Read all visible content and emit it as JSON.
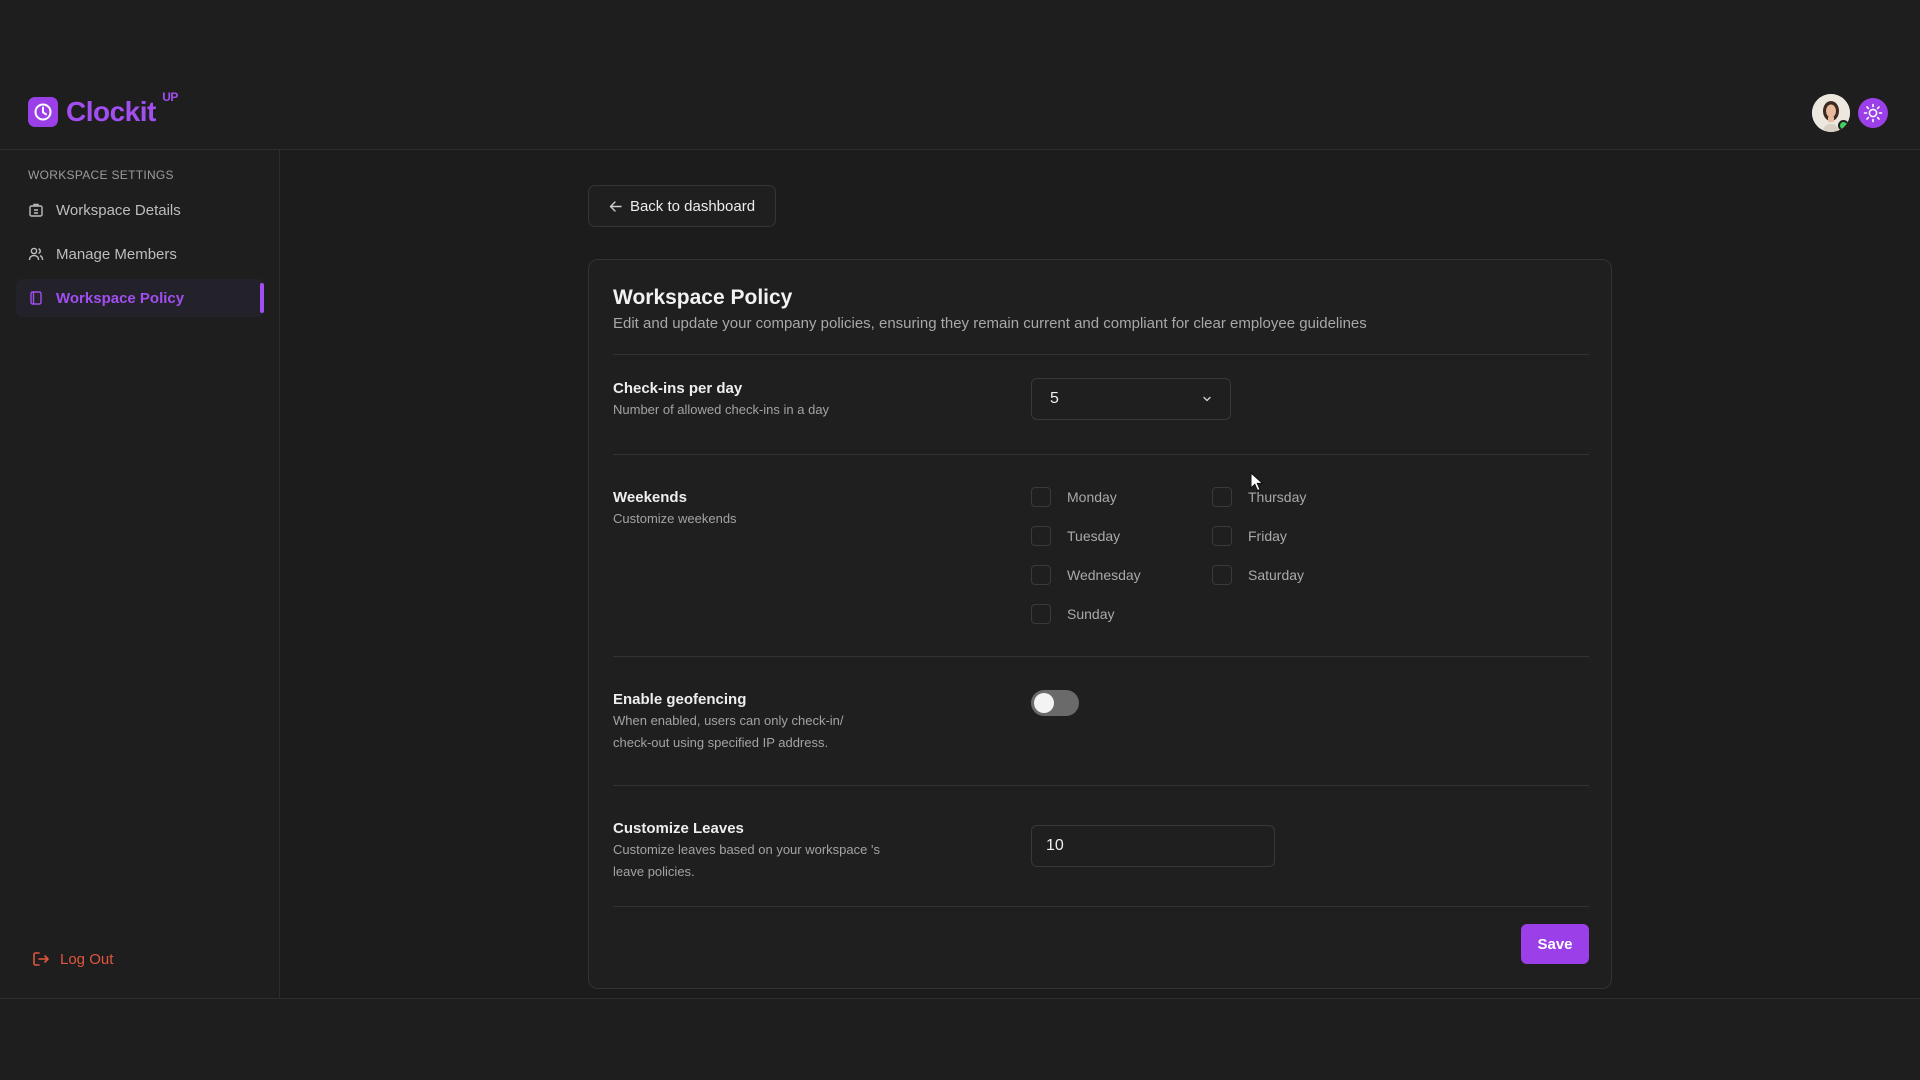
{
  "app": {
    "logo_text": "Clockit",
    "logo_sup": "UP"
  },
  "sidebar": {
    "heading": "WORKSPACE SETTINGS",
    "items": [
      {
        "label": "Workspace Details",
        "icon": "building-icon"
      },
      {
        "label": "Manage Members",
        "icon": "users-icon"
      },
      {
        "label": "Workspace Policy",
        "icon": "document-icon",
        "active": true
      }
    ],
    "logout_label": "Log Out"
  },
  "back_button": {
    "label": "Back to dashboard"
  },
  "policy": {
    "title": "Workspace Policy",
    "subtitle": "Edit and update your company policies, ensuring they remain current and compliant for clear employee guidelines",
    "checkins": {
      "label": "Check-ins per day",
      "desc": "Number of allowed check-ins in a day",
      "value": "5"
    },
    "weekends": {
      "label": "Weekends",
      "desc": "Customize weekends",
      "days": [
        "Monday",
        "Tuesday",
        "Wednesday",
        "Sunday",
        "Thursday",
        "Friday",
        "Saturday"
      ]
    },
    "geofencing": {
      "label": "Enable geofencing",
      "desc_line1": "When enabled, users can only check-in/",
      "desc_line2": "check-out using specified IP address.",
      "enabled": false
    },
    "leaves": {
      "label": "Customize Leaves",
      "desc_line1": "Customize leaves based on your workspace 's",
      "desc_line2": "leave policies.",
      "value": "10"
    },
    "save_label": "Save"
  },
  "colors": {
    "accent": "#9b3fe8",
    "logout": "#e0573d",
    "online": "#3fcf5a"
  }
}
